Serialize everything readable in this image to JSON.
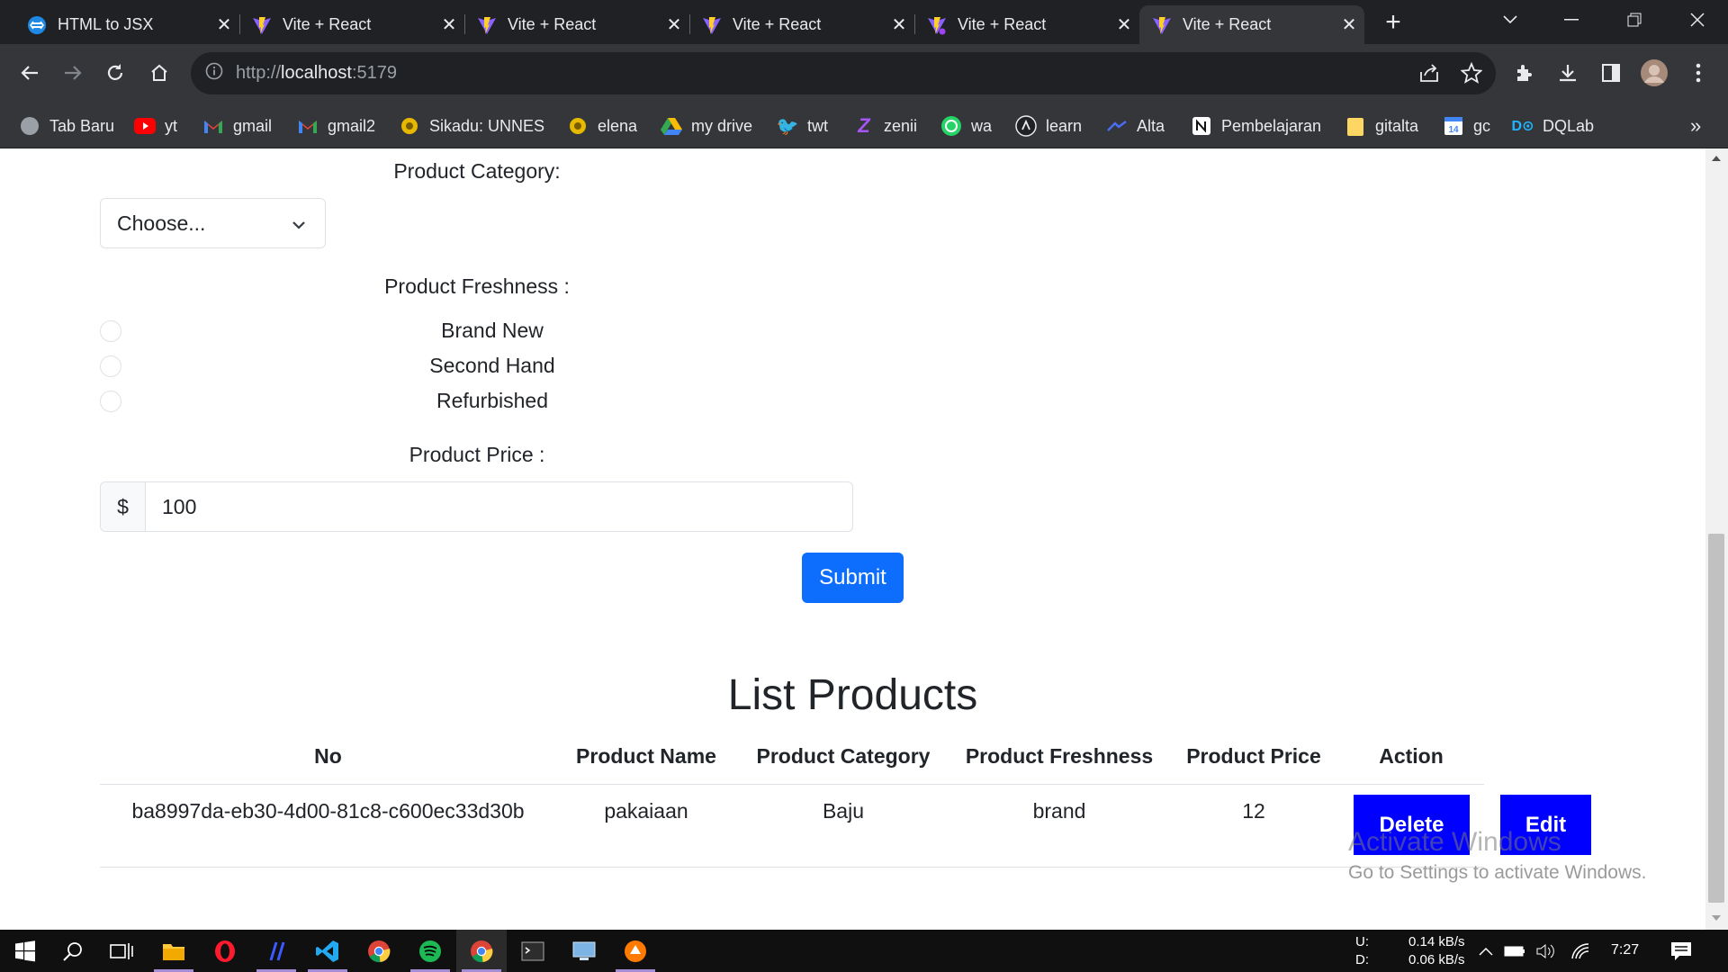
{
  "browser": {
    "tabs": [
      {
        "title": "HTML to JSX",
        "icon": "html-to-jsx-icon",
        "active": false
      },
      {
        "title": "Vite + React",
        "icon": "vite-icon",
        "active": false
      },
      {
        "title": "Vite + React",
        "icon": "vite-icon",
        "active": false
      },
      {
        "title": "Vite + React",
        "icon": "vite-icon",
        "active": false
      },
      {
        "title": "Vite + React",
        "icon": "vite-icon",
        "active": false
      },
      {
        "title": "Vite + React",
        "icon": "vite-icon",
        "active": true
      }
    ],
    "url": {
      "scheme": "http://",
      "host": "localhost",
      "port": ":5179"
    },
    "bookmarks": [
      {
        "label": "Tab Baru",
        "icon": "globe-icon",
        "color": "#9aa0a6"
      },
      {
        "label": "yt",
        "icon": "youtube-icon",
        "color": "#ff0000"
      },
      {
        "label": "gmail",
        "icon": "gmail-icon",
        "color": "#ea4335"
      },
      {
        "label": "gmail2",
        "icon": "gmail-icon",
        "color": "#ea4335"
      },
      {
        "label": "Sikadu: UNNES",
        "icon": "unnes-icon",
        "color": "#e6b800"
      },
      {
        "label": "elena",
        "icon": "unnes-icon",
        "color": "#e6b800"
      },
      {
        "label": "my drive",
        "icon": "drive-icon",
        "color": "#34a853"
      },
      {
        "label": "twt",
        "icon": "twitter-icon",
        "color": "#1d9bf0"
      },
      {
        "label": "zenii",
        "icon": "zenius-icon",
        "color": "#9b59b6"
      },
      {
        "label": "wa",
        "icon": "whatsapp-icon",
        "color": "#25d366"
      },
      {
        "label": "learn",
        "icon": "learn-icon",
        "color": "#e8eaed"
      },
      {
        "label": "Alta",
        "icon": "alta-icon",
        "color": "#4a6cf7"
      },
      {
        "label": "Pembelajaran",
        "icon": "notion-icon",
        "color": "#ffffff"
      },
      {
        "label": "gitalta",
        "icon": "folder-icon",
        "color": "#f9c74f"
      },
      {
        "label": "gc",
        "icon": "calendar-icon",
        "color": "#4285f4"
      },
      {
        "label": "DQLab",
        "icon": "dqlab-icon",
        "color": "#1fb6ff"
      }
    ],
    "bookmarks_overflow": "»"
  },
  "form": {
    "category_label": "Product Category:",
    "category_value": "Choose...",
    "freshness_label": "Product Freshness :",
    "freshness_options": [
      "Brand New",
      "Second Hand",
      "Refurbished"
    ],
    "price_label": "Product Price :",
    "price_prefix": "$",
    "price_value": "100",
    "submit_label": "Submit"
  },
  "list": {
    "title": "List Products",
    "headers": [
      "No",
      "Product Name",
      "Product Category",
      "Product Freshness",
      "Product Price",
      "Action"
    ],
    "rows": [
      {
        "no": "ba8997da-eb30-4d00-81c8-c600ec33d30b",
        "name": "pakaiaan",
        "category": "Baju",
        "freshness": "brand",
        "price": "12"
      }
    ],
    "delete_label": "Delete",
    "edit_label": "Edit"
  },
  "watermark": {
    "line1": "Activate Windows",
    "line2": "Go to Settings to activate Windows."
  },
  "taskbar": {
    "upload_label": "U:",
    "download_label": "D:",
    "upload_speed": "0.14 kB/s",
    "download_speed": "0.06 kB/s",
    "clock": "7:27"
  },
  "colors": {
    "primary": "#0d6efd",
    "action_button": "#0000ff",
    "chrome_dark": "#202124",
    "chrome_toolbar": "#35363a"
  }
}
